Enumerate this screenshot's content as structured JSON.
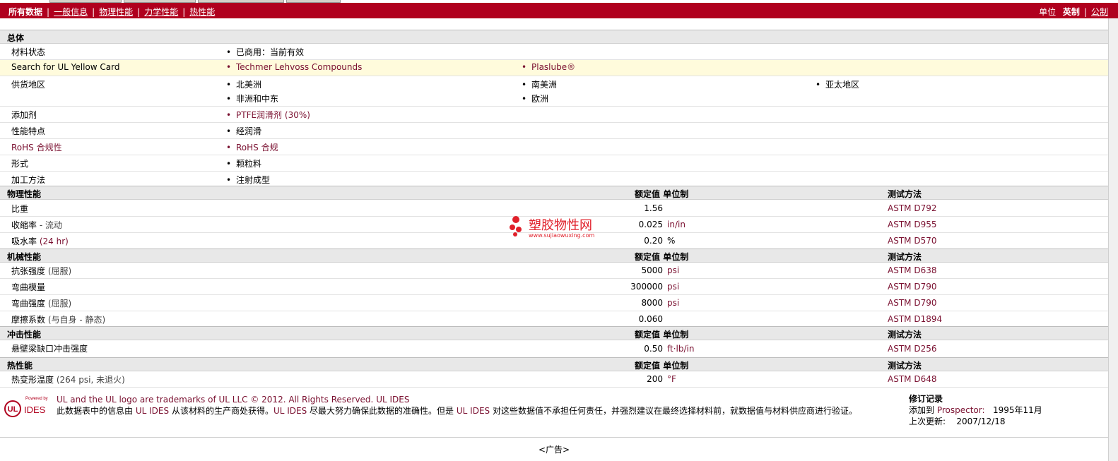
{
  "topnav": {
    "all_data": "所有数据",
    "sep": "|",
    "links": [
      "一般信息",
      "物理性能",
      "力学性能",
      "热性能"
    ],
    "unit_label": "单位",
    "unit_en": "英制",
    "unit_metric": "公制"
  },
  "general": {
    "title": "总体",
    "rows": [
      {
        "label": "材料状态",
        "items": [
          "已商用：当前有效"
        ]
      },
      {
        "label": "Search for UL Yellow Card",
        "items": [
          "Techmer Lehvoss Compounds",
          "Plaslube®"
        ]
      },
      {
        "label": "供货地区",
        "items": [
          "北美洲",
          "南美洲",
          "亚太地区",
          "非洲和中东",
          "欧洲"
        ]
      },
      {
        "label": "添加剂",
        "items": [
          "PTFE润滑剂",
          "(30%)"
        ]
      },
      {
        "label": "性能特点",
        "items": [
          "经润滑"
        ]
      },
      {
        "label": "RoHS 合规性",
        "items": [
          "RoHS 合规"
        ]
      },
      {
        "label": "形式",
        "items": [
          "颗粒料"
        ]
      },
      {
        "label": "加工方法",
        "items": [
          "注射成型"
        ]
      }
    ]
  },
  "headers": {
    "nominal": "额定值",
    "unit": "单位制",
    "test": "测试方法"
  },
  "physical": {
    "title": "物理性能",
    "rows": [
      {
        "label": "比重",
        "cond": "",
        "value": "1.56",
        "unit": "",
        "test": "ASTM D792"
      },
      {
        "label": "收缩率",
        "cond": " - 流动",
        "value": "0.025",
        "unit": "in/in",
        "test": "ASTM D955"
      },
      {
        "label": "吸水率",
        "cond": "(24 hr)",
        "value": "0.20",
        "unit": "%",
        "test": "ASTM D570"
      }
    ]
  },
  "mechanical": {
    "title": "机械性能",
    "rows": [
      {
        "label": "抗张强度",
        "cond": "(屈服)",
        "value": "5000",
        "unit": "psi",
        "test": "ASTM D638"
      },
      {
        "label": "弯曲模量",
        "cond": "",
        "value": "300000",
        "unit": "psi",
        "test": "ASTM D790"
      },
      {
        "label": "弯曲强度",
        "cond": "(屈服)",
        "value": "8000",
        "unit": "psi",
        "test": "ASTM D790"
      },
      {
        "label": "摩擦系数",
        "cond": "(与自身 - 静态)",
        "value": "0.060",
        "unit": "",
        "test": "ASTM D1894"
      }
    ]
  },
  "impact": {
    "title": "冲击性能",
    "rows": [
      {
        "label": "悬壁梁缺口冲击强度",
        "cond": "",
        "value": "0.50",
        "unit": "ft·lb/in",
        "test": "ASTM D256"
      }
    ]
  },
  "thermal": {
    "title": "热性能",
    "rows": [
      {
        "label": "热变形温度",
        "cond": "(264 psi, 未退火)",
        "value": "200",
        "unit": "°F",
        "test": "ASTM D648"
      }
    ]
  },
  "watermark": {
    "cn": "塑胶物性网",
    "url": "www.sujiaowuxing.com"
  },
  "footer": {
    "logo_powered": "Powered by",
    "logo_ul": "UL",
    "logo_ides": "IDES",
    "line1": "UL and the UL logo are trademarks of UL LLC © 2012. All Rights Reserved.",
    "line1_link": "UL IDES",
    "line2_a": "此数据表中的信息由",
    "line2_b": "UL IDES",
    "line2_c": "从该材料的生产商处获得。",
    "line2_d": "UL IDES",
    "line2_e": "尽最大努力确保此数据的准确性。但是",
    "line2_f": "UL IDES",
    "line2_g": "对这些数据值不承担任何责任，并强烈建议在最终选择材料前，就数据值与材料供应商进行验证。",
    "rev_title": "修订记录",
    "rev_added_label": "添加到",
    "rev_added_link": "Prospector:",
    "rev_added_date": "1995年11月",
    "rev_updated_label": "上次更新:",
    "rev_updated_date": "2007/12/18"
  },
  "ad": "<广告>",
  "colors": {
    "brand": "#b0001e",
    "link": "#7a1030",
    "highlight": "#fffbdc",
    "section": "#e8e8e8"
  }
}
